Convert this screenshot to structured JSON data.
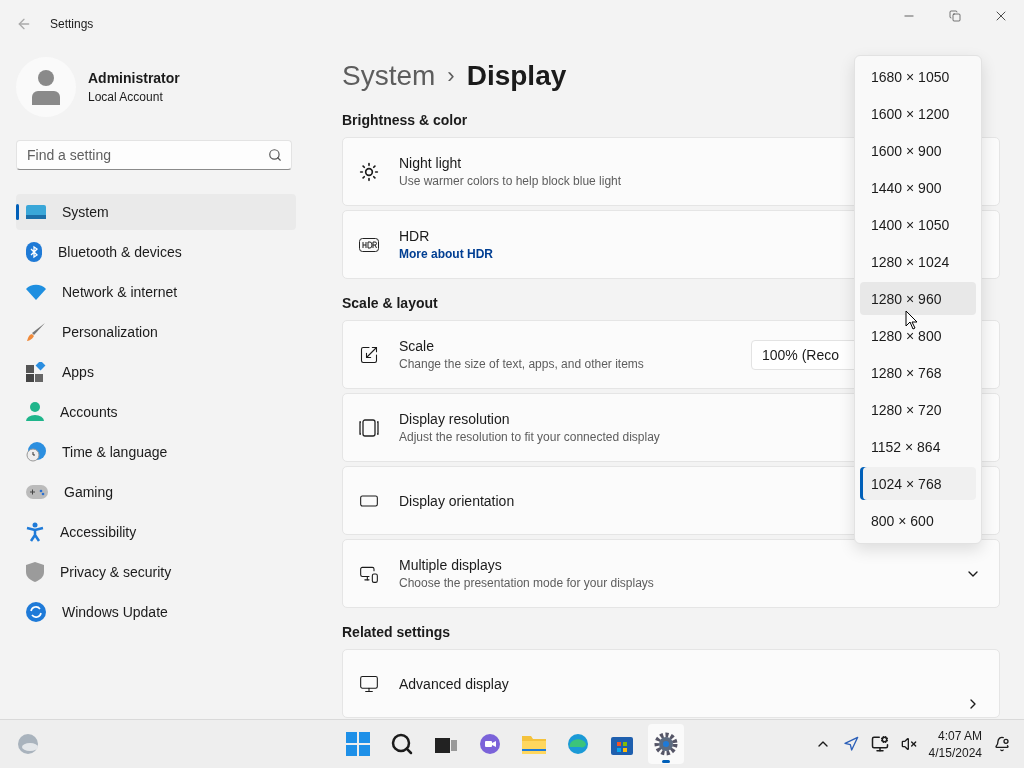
{
  "window": {
    "title": "Settings"
  },
  "user": {
    "name": "Administrator",
    "account": "Local Account"
  },
  "search": {
    "placeholder": "Find a setting"
  },
  "sidebar": {
    "items": [
      {
        "label": "System",
        "selected": true
      },
      {
        "label": "Bluetooth & devices",
        "selected": false
      },
      {
        "label": "Network & internet",
        "selected": false
      },
      {
        "label": "Personalization",
        "selected": false
      },
      {
        "label": "Apps",
        "selected": false
      },
      {
        "label": "Accounts",
        "selected": false
      },
      {
        "label": "Time & language",
        "selected": false
      },
      {
        "label": "Gaming",
        "selected": false
      },
      {
        "label": "Accessibility",
        "selected": false
      },
      {
        "label": "Privacy & security",
        "selected": false
      },
      {
        "label": "Windows Update",
        "selected": false
      }
    ]
  },
  "breadcrumb": {
    "parent": "System",
    "separator": "›",
    "current": "Display"
  },
  "sections": [
    {
      "title": "Brightness & color",
      "cards": [
        {
          "title": "Night light",
          "subtitle": "Use warmer colors to help block blue light"
        },
        {
          "title": "HDR",
          "link": "More about HDR"
        }
      ]
    },
    {
      "title": "Scale & layout",
      "cards": [
        {
          "title": "Scale",
          "subtitle": "Change the size of text, apps, and other items",
          "control": {
            "kind": "dropdown",
            "value": "100% (Reco"
          }
        },
        {
          "title": "Display resolution",
          "subtitle": "Adjust the resolution to fit your connected display"
        },
        {
          "title": "Display orientation"
        },
        {
          "title": "Multiple displays",
          "subtitle": "Choose the presentation mode for your displays",
          "control": {
            "kind": "expand"
          }
        }
      ]
    },
    {
      "title": "Related settings",
      "cards": [
        {
          "title": "Advanced display",
          "control": {
            "kind": "link"
          }
        }
      ]
    }
  ],
  "resolution_menu": {
    "items": [
      {
        "label": "1680 × 1050",
        "selected": false,
        "hovered": false
      },
      {
        "label": "1600 × 1200",
        "selected": false,
        "hovered": false
      },
      {
        "label": "1600 × 900",
        "selected": false,
        "hovered": false
      },
      {
        "label": "1440 × 900",
        "selected": false,
        "hovered": false
      },
      {
        "label": "1400 × 1050",
        "selected": false,
        "hovered": false
      },
      {
        "label": "1280 × 1024",
        "selected": false,
        "hovered": false
      },
      {
        "label": "1280 × 960",
        "selected": false,
        "hovered": true
      },
      {
        "label": "1280 × 800",
        "selected": false,
        "hovered": false
      },
      {
        "label": "1280 × 768",
        "selected": false,
        "hovered": false
      },
      {
        "label": "1280 × 720",
        "selected": false,
        "hovered": false
      },
      {
        "label": "1152 × 864",
        "selected": false,
        "hovered": false
      },
      {
        "label": "1024 × 768",
        "selected": true,
        "hovered": false
      },
      {
        "label": "800 × 600",
        "selected": false,
        "hovered": false
      }
    ]
  },
  "taskbar": {
    "apps": [
      {
        "selected": false
      },
      {
        "selected": false
      },
      {
        "selected": false
      },
      {
        "selected": false
      },
      {
        "selected": false
      },
      {
        "selected": false
      },
      {
        "selected": false
      },
      {
        "selected": true
      }
    ],
    "time": "4:07 AM",
    "date": "4/15/2024"
  }
}
